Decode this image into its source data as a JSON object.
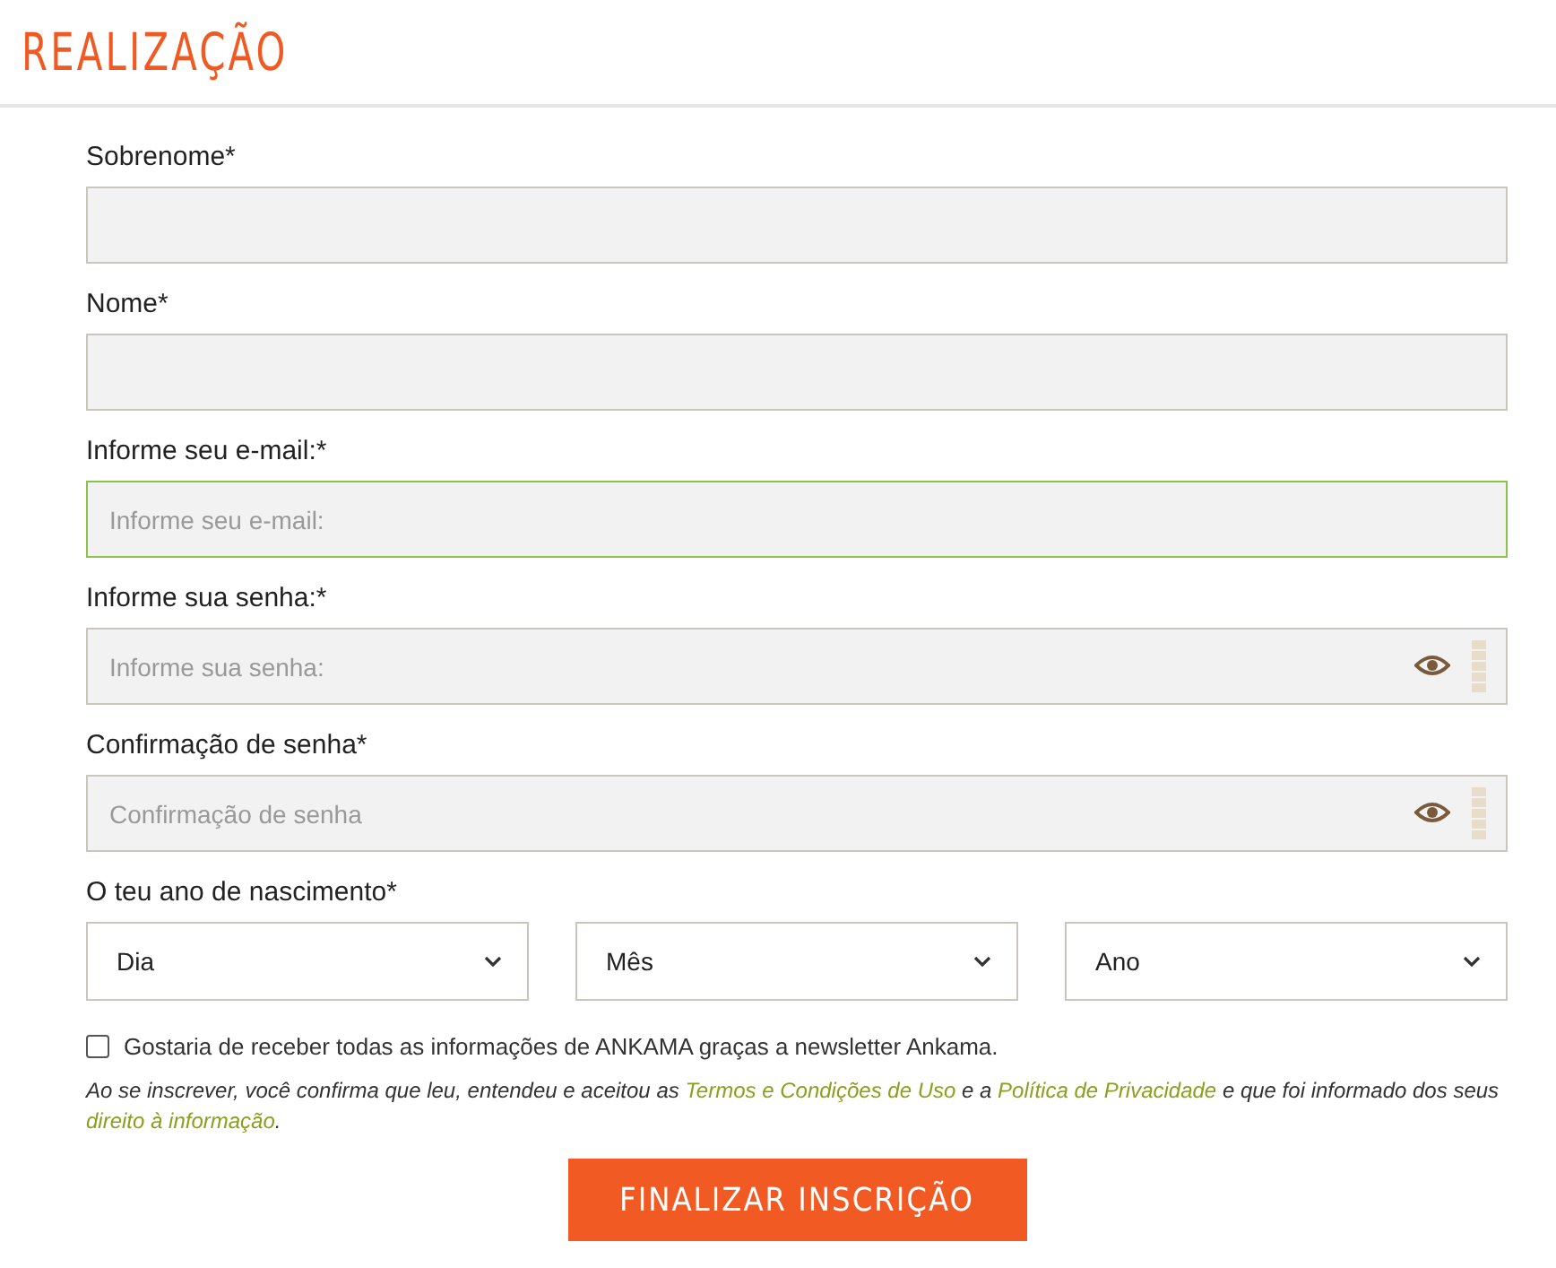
{
  "title": "REALIZAÇÃO",
  "fields": [
    {
      "kind": "text",
      "label": "Sobrenome*",
      "focused": false
    },
    {
      "kind": "text",
      "label": "Nome*",
      "focused": false
    },
    {
      "kind": "text",
      "label": "Informe seu e-mail:*",
      "placeholder": "Informe seu e-mail:",
      "focused": true
    },
    {
      "kind": "password",
      "label": "Informe sua senha:*",
      "placeholder": "Informe sua senha:",
      "focused": false
    },
    {
      "kind": "password",
      "label": "Confirmação de senha*",
      "placeholder": "Confirmação de senha",
      "focused": false
    }
  ],
  "birth": {
    "label": "O teu ano de nascimento*",
    "selects": [
      "Dia",
      "Mês",
      "Ano"
    ]
  },
  "newsletter": {
    "label": "Gostaria de receber todas as informações de ANKAMA graças a newsletter Ankama.",
    "checked": false
  },
  "legal": [
    {
      "kind": "text",
      "text": "Ao se inscrever, você confirma que leu, entendeu e aceitou as "
    },
    {
      "kind": "link",
      "text": "Termos e Condições de Uso"
    },
    {
      "kind": "text",
      "text": " e a "
    },
    {
      "kind": "link",
      "text": "Política de Privacidade"
    },
    {
      "kind": "text",
      "text": " e que foi informado dos seus "
    },
    {
      "kind": "link",
      "text": "direito à informação"
    },
    {
      "kind": "text",
      "text": "."
    }
  ],
  "submit": "FINALIZAR INSCRIÇÃO"
}
